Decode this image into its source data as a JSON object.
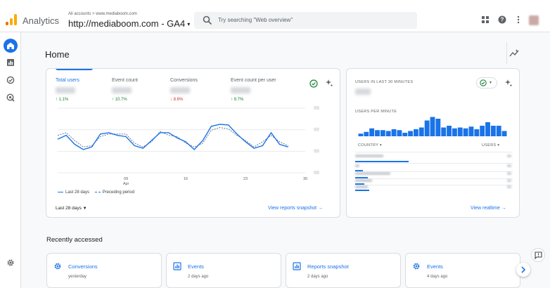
{
  "header": {
    "app_name": "Analytics",
    "breadcrumb": "All accounts > www.mediaboom.com",
    "property": "http://mediaboom.com - GA4",
    "search_placeholder": "Try searching \"Web overview\""
  },
  "icons": {
    "logo": "analytics-logo-icon",
    "search": "search-icon",
    "apps": "apps-grid-icon",
    "help": "help-icon",
    "more": "more-vert-icon"
  },
  "colors": {
    "accent": "#1a73e8",
    "up": "#188038",
    "down": "#d93025",
    "logo_orange": "#f9ab00",
    "logo_dark": "#e37400"
  },
  "home": {
    "title": "Home"
  },
  "metrics": [
    {
      "label": "Total users",
      "change": "↑ 1.1%",
      "direction": "up"
    },
    {
      "label": "Event count",
      "change": "↑ 10.7%",
      "direction": "up"
    },
    {
      "label": "Conversions",
      "change": "↓ 8.6%",
      "direction": "down"
    },
    {
      "label": "Event count per user",
      "change": "↑ 9.7%",
      "direction": "up"
    }
  ],
  "chart_data": {
    "type": "line",
    "x": [
      1,
      2,
      3,
      4,
      5,
      6,
      7,
      8,
      9,
      10,
      11,
      12,
      13,
      14,
      15,
      16,
      17,
      18,
      19,
      20,
      21,
      22,
      23,
      24,
      25,
      26,
      27,
      28
    ],
    "x_tick_labels": [
      {
        "at": 9,
        "label": "09",
        "sublabel": "Apr"
      },
      {
        "at": 16,
        "label": "16"
      },
      {
        "at": 23,
        "label": "23"
      },
      {
        "at": 30,
        "label": "30"
      }
    ],
    "series": [
      {
        "name": "Last 28 days",
        "style": "solid",
        "values": [
          52,
          58,
          44,
          36,
          40,
          60,
          62,
          58,
          56,
          42,
          38,
          50,
          62,
          62,
          54,
          48,
          36,
          50,
          72,
          75,
          74,
          60,
          48,
          38,
          42,
          62,
          44,
          40
        ]
      },
      {
        "name": "Preceding period",
        "style": "dashed",
        "values": [
          58,
          62,
          50,
          40,
          42,
          56,
          60,
          60,
          60,
          46,
          40,
          48,
          64,
          58,
          56,
          46,
          40,
          46,
          66,
          70,
          68,
          58,
          50,
          40,
          48,
          58,
          48,
          42
        ]
      }
    ],
    "legend_position": "bottom-left",
    "grid": true
  },
  "main_card": {
    "date_range": "Last 28 days",
    "view_link": "View reports snapshot →"
  },
  "realtime": {
    "title": "USERS IN LAST 30 MINUTES",
    "per_minute_label": "USERS PER MINUTE",
    "per_minute_values": [
      3,
      5,
      9,
      7,
      7,
      6,
      8,
      7,
      4,
      6,
      8,
      10,
      18,
      22,
      20,
      10,
      12,
      9,
      10,
      9,
      11,
      8,
      12,
      16,
      12,
      12,
      6
    ],
    "country_header": "COUNTRY ▾",
    "users_header": "USERS ▾",
    "row_bars": [
      0.34,
      0.05,
      0.08,
      0.06,
      0.09
    ],
    "view_link": "View realtime →"
  },
  "recent": {
    "title": "Recently accessed",
    "items": [
      {
        "name": "Conversions",
        "time": "yesterday",
        "icon": "conversions-icon"
      },
      {
        "name": "Events",
        "time": "2 days ago",
        "icon": "report-icon"
      },
      {
        "name": "Reports snapshot",
        "time": "2 days ago",
        "icon": "report-icon"
      },
      {
        "name": "Events",
        "time": "4 days ago",
        "icon": "conversions-icon"
      }
    ]
  }
}
